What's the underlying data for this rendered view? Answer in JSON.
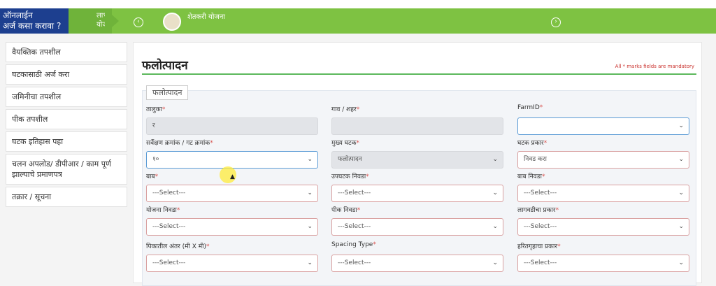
{
  "header": {
    "online_line1": "ऑनलाईन",
    "online_line2": "अर्ज कसा करावा ?",
    "benefit_line1": "लाभ",
    "benefit_line2": "योजना",
    "scheme_label": "शेतकरी योजना",
    "prev_icon": "left-circle-arrow",
    "next_icon": "right-circle-arrow"
  },
  "sidebar": {
    "items": [
      "वैयक्तिक तपशील",
      "घटकासाठी अर्ज करा",
      "जमिनीचा तपशील",
      "पीक तपशील",
      "घटक इतिहास पहा",
      "चलन अपलोड/ डीपीआर / काम पूर्ण झाल्याचे प्रमाणपत्र",
      "तक्रार / सूचना"
    ]
  },
  "form": {
    "title": "फलोत्पादन",
    "mandatory_note": "All * marks fields are mandatory",
    "legend": "फलोत्पादन",
    "fields": [
      {
        "label": "तालुका",
        "value": "र"
      },
      {
        "label": "गाव / शहर",
        "value": ""
      },
      {
        "label": "FarmID",
        "value": ""
      },
      {
        "label": "सर्वेक्षण क्रमांक / गट क्रमांक",
        "value": "१०"
      },
      {
        "label": "मुख्य घटक",
        "value": "फलोत्पादन"
      },
      {
        "label": "घटक प्रकार",
        "value": "निवड करा"
      },
      {
        "label": "बाब",
        "value": "---Select---"
      },
      {
        "label": "उपघटक निवडा",
        "value": "---Select---"
      },
      {
        "label": "बाब निवडा",
        "value": "---Select---"
      },
      {
        "label": "योजना निवडा",
        "value": "---Select---"
      },
      {
        "label": "पीक निवडा",
        "value": "---Select---"
      },
      {
        "label": "लागवडीचा प्रकार",
        "value": "---Select---"
      },
      {
        "label": "पिकातील अंतर (मी X मी)",
        "value": "---Select---"
      },
      {
        "label": "Spacing Type",
        "value": "---Select---"
      },
      {
        "label": "हरितगृहाचा प्रकार",
        "value": "---Select---"
      }
    ]
  },
  "colors": {
    "header_green": "#7ec242",
    "header_blue": "#1d3f8f",
    "accent_line": "#5cb85c",
    "required_star": "#d9534f"
  }
}
